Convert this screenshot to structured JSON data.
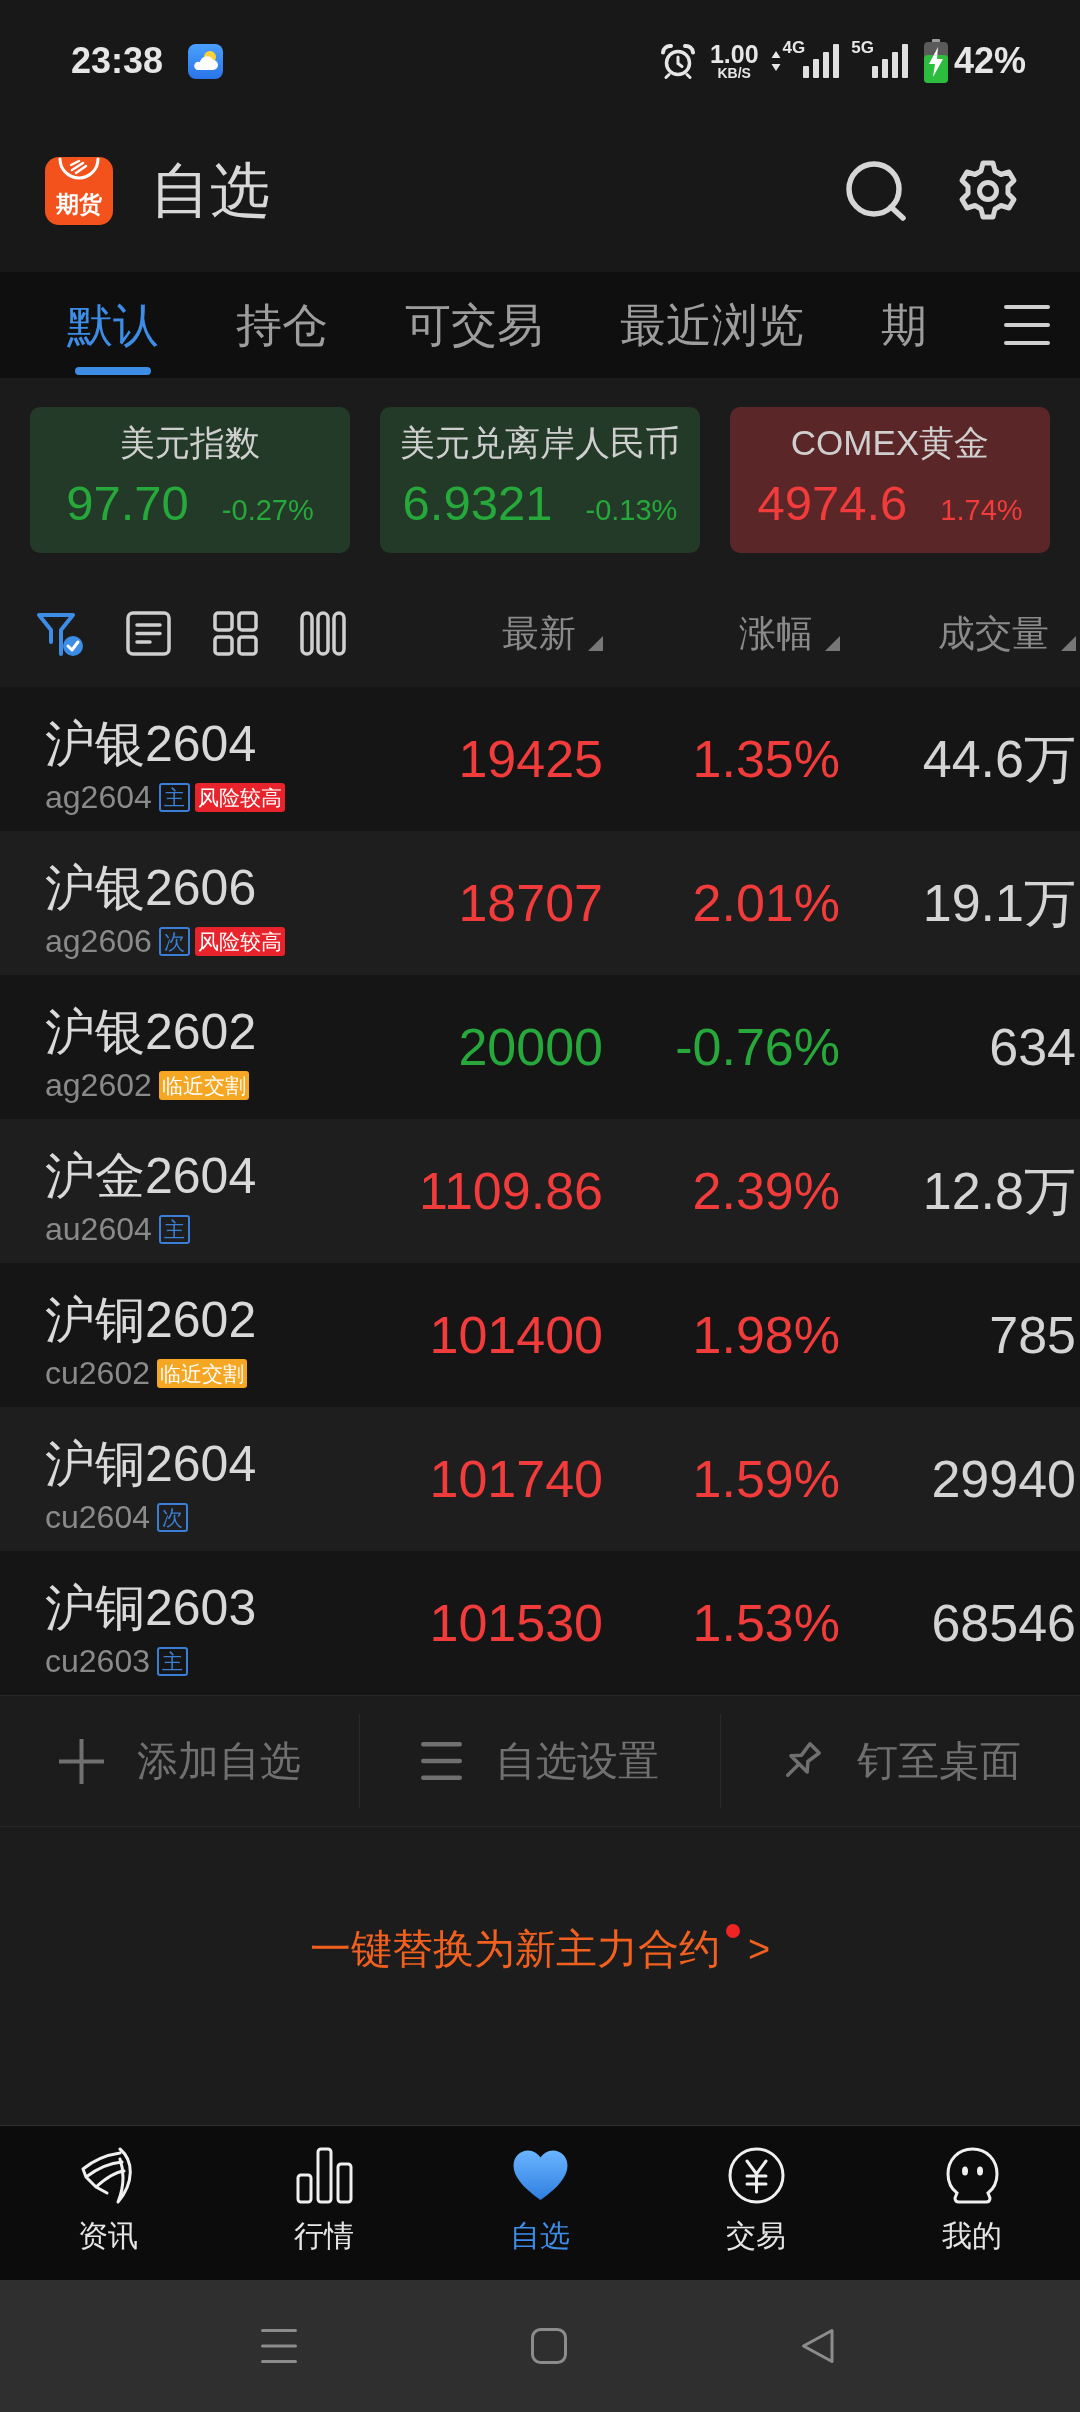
{
  "status_bar": {
    "time": "23:38",
    "speed": "1.00",
    "speed_unit": "KB/S",
    "network_1": "4G",
    "network_2": "5G",
    "battery": "42%"
  },
  "header": {
    "logo_text": "期货",
    "title": "自选"
  },
  "tabs": [
    {
      "label": "默认",
      "selected": true
    },
    {
      "label": "持仓",
      "selected": false
    },
    {
      "label": "可交易",
      "selected": false
    },
    {
      "label": "最近浏览",
      "selected": false
    },
    {
      "label": "期",
      "selected": false
    }
  ],
  "cards": [
    {
      "title": "美元指数",
      "value": "97.70",
      "change": "-0.27%",
      "rising": false
    },
    {
      "title": "美元兑离岸人民币",
      "value": "6.9321",
      "change": "-0.13%",
      "rising": false
    },
    {
      "title": "COMEX黄金",
      "value": "4974.6",
      "change": "1.74%",
      "rising": true
    }
  ],
  "toolbar": {
    "filter_active": true
  },
  "columns": [
    {
      "label": "最新"
    },
    {
      "label": "涨幅"
    },
    {
      "label": "成交量"
    }
  ],
  "rows": [
    {
      "name": "沪银2604",
      "code": "ag2604",
      "badges": [
        {
          "text": "主",
          "kind": "outline",
          "color": "#3a7fd5"
        },
        {
          "text": "风险较高",
          "kind": "filled",
          "color": "#e8232b"
        }
      ],
      "price": "19425",
      "change": "1.35%",
      "volume": "44.6万",
      "rising": true
    },
    {
      "name": "沪银2606",
      "code": "ag2606",
      "badges": [
        {
          "text": "次",
          "kind": "outline",
          "color": "#3a7fd5"
        },
        {
          "text": "风险较高",
          "kind": "filled",
          "color": "#e8232b"
        }
      ],
      "price": "18707",
      "change": "2.01%",
      "volume": "19.1万",
      "rising": true
    },
    {
      "name": "沪银2602",
      "code": "ag2602",
      "badges": [
        {
          "text": "临近交割",
          "kind": "filled",
          "color": "#f5a623"
        }
      ],
      "price": "20000",
      "change": "-0.76%",
      "volume": "634",
      "rising": false
    },
    {
      "name": "沪金2604",
      "code": "au2604",
      "badges": [
        {
          "text": "主",
          "kind": "outline",
          "color": "#3a7fd5"
        }
      ],
      "price": "1109.86",
      "change": "2.39%",
      "volume": "12.8万",
      "rising": true
    },
    {
      "name": "沪铜2602",
      "code": "cu2602",
      "badges": [
        {
          "text": "临近交割",
          "kind": "filled",
          "color": "#f5a623"
        }
      ],
      "price": "101400",
      "change": "1.98%",
      "volume": "785",
      "rising": true
    },
    {
      "name": "沪铜2604",
      "code": "cu2604",
      "badges": [
        {
          "text": "次",
          "kind": "outline",
          "color": "#3a7fd5"
        }
      ],
      "price": "101740",
      "change": "1.59%",
      "volume": "29940",
      "rising": true
    },
    {
      "name": "沪铜2603",
      "code": "cu2603",
      "badges": [
        {
          "text": "主",
          "kind": "outline",
          "color": "#3a7fd5"
        }
      ],
      "price": "101530",
      "change": "1.53%",
      "volume": "68546",
      "rising": true
    }
  ],
  "actions": [
    {
      "label": "添加自选",
      "kind": "add"
    },
    {
      "label": "自选设置",
      "kind": "settings"
    },
    {
      "label": "钉至桌面",
      "kind": "pin"
    }
  ],
  "promo": {
    "text": "一键替换为新主力合约",
    "dot": true,
    "arrow": ">"
  },
  "bottom_nav": [
    {
      "label": "资讯",
      "kind": "news",
      "selected": false
    },
    {
      "label": "行情",
      "kind": "quotes",
      "selected": false
    },
    {
      "label": "自选",
      "kind": "watchlist",
      "selected": true
    },
    {
      "label": "交易",
      "kind": "trade",
      "selected": false
    },
    {
      "label": "我的",
      "kind": "profile",
      "selected": false
    }
  ]
}
